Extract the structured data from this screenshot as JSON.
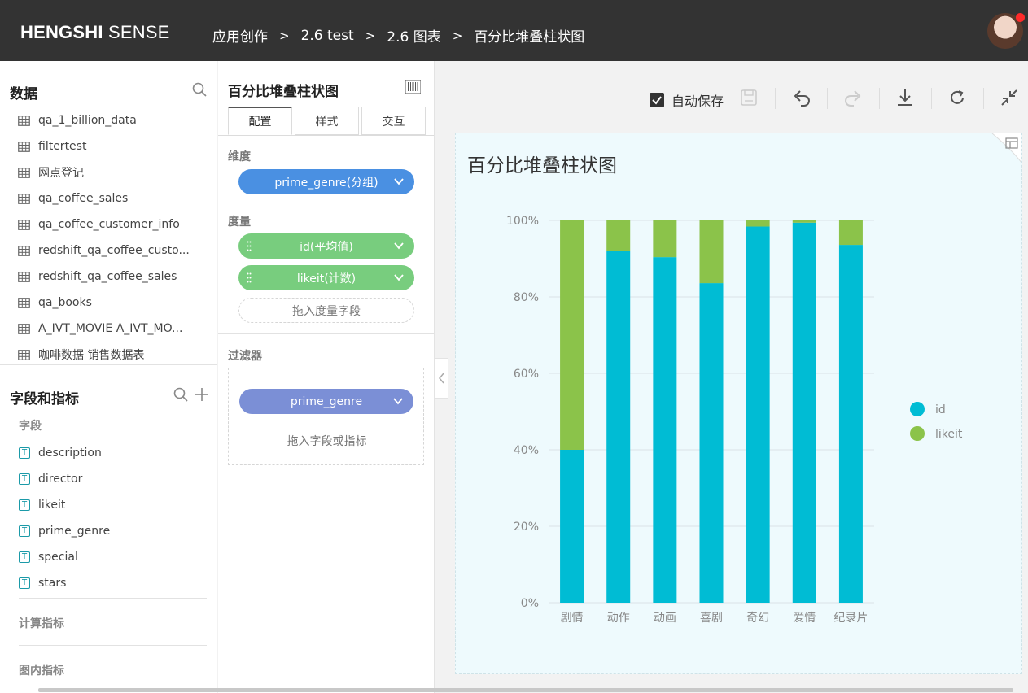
{
  "app": {
    "brand_bold": "HENGSHI",
    "brand_rest": " SENSE"
  },
  "breadcrumb": [
    "应用创作",
    "2.6 test",
    "2.6 图表",
    "百分比堆叠柱状图"
  ],
  "breadcrumb_sep": ">",
  "data_panel": {
    "title": "数据",
    "datasets": [
      "qa_1_billion_data",
      "filtertest",
      "网点登记",
      "qa_coffee_sales",
      "qa_coffee_customer_info",
      "redshift_qa_coffee_custo...",
      "redshift_qa_coffee_sales",
      "qa_books",
      "A_IVT_MOVIE A_IVT_MO...",
      "咖啡数据 销售数据表"
    ]
  },
  "fields_panel": {
    "title": "字段和指标",
    "fields_label": "字段",
    "fields": [
      "description",
      "director",
      "likeit",
      "prime_genre",
      "special",
      "stars"
    ],
    "field_type_glyph": "T",
    "calc_label": "计算指标",
    "chart_metrics_label": "图内指标"
  },
  "config_panel": {
    "chart_name": "百分比堆叠柱状图",
    "tabs": [
      "配置",
      "样式",
      "交互"
    ],
    "dimension_label": "维度",
    "dimension_pill": "prime_genre(分组)",
    "measure_label": "度量",
    "measure_pills": [
      "id(平均值)",
      "likeit(计数)"
    ],
    "measure_placeholder": "拖入度量字段",
    "filter_label": "过滤器",
    "filter_pill": "prime_genre",
    "filter_placeholder": "拖入字段或指标"
  },
  "toolbar": {
    "autosave_label": "自动保存",
    "autosave_checked": true
  },
  "colors": {
    "topbar": "#333333",
    "dim_pill": "#4a90e2",
    "measure_pill": "#78cd7e",
    "filter_pill": "#7b8fd6",
    "series_id": "#00bcd4",
    "series_likeit": "#8bc34a"
  },
  "chart_data": {
    "type": "bar",
    "stacked": "percent",
    "title": "百分比堆叠柱状图",
    "categories": [
      "剧情",
      "动作",
      "动画",
      "喜剧",
      "奇幻",
      "爱情",
      "纪录片"
    ],
    "series": [
      {
        "name": "id",
        "values": [
          40,
          92,
          90.4,
          83.6,
          98.4,
          99.4,
          93.6
        ]
      },
      {
        "name": "likeit",
        "values": [
          60,
          8,
          9.6,
          16.4,
          1.6,
          0.6,
          6.4
        ]
      }
    ],
    "ylim": [
      0,
      100
    ],
    "yticks": [
      "0%",
      "20%",
      "40%",
      "60%",
      "80%",
      "100%"
    ],
    "legend_position": "right",
    "grid": true
  }
}
